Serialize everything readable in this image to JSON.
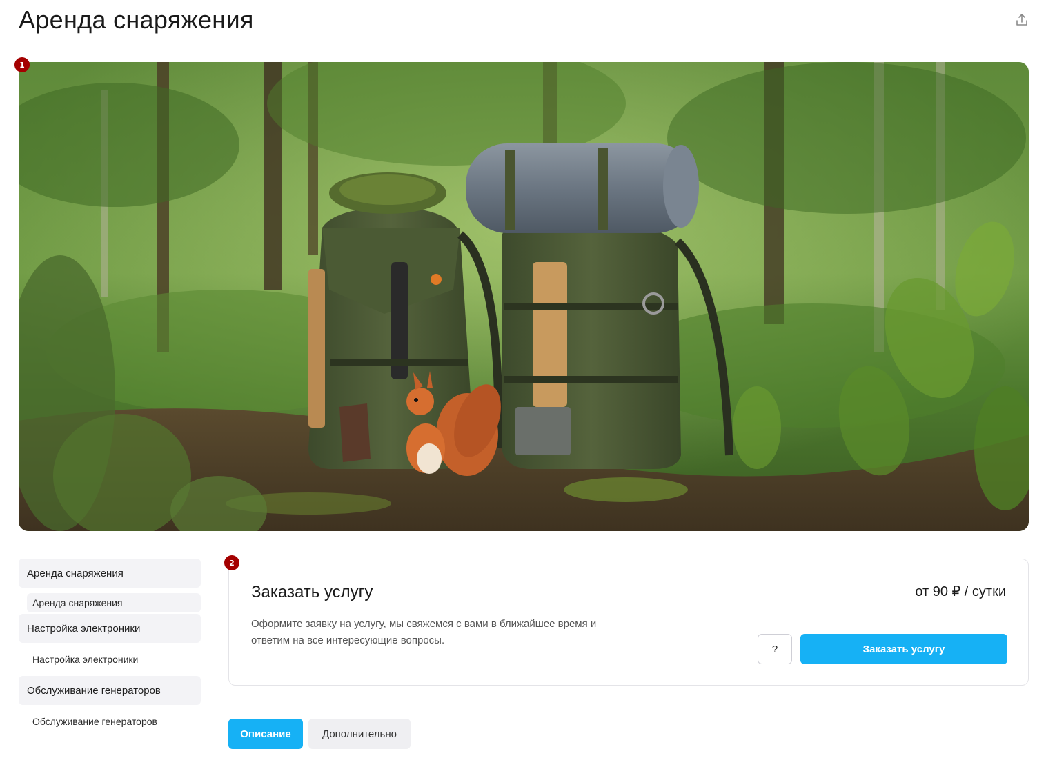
{
  "page": {
    "title": "Аренда снаряжения"
  },
  "markers": [
    "1",
    "2"
  ],
  "icons": {
    "share": "share-upload-icon"
  },
  "sidebar": {
    "items": [
      {
        "label": "Аренда снаряжения",
        "sub": "Аренда снаряжения"
      },
      {
        "label": "Настройка электроники",
        "sub": "Настройка электроники"
      },
      {
        "label": "Обслуживание генераторов",
        "sub": "Обслуживание генераторов"
      }
    ]
  },
  "service": {
    "title": "Заказать услугу",
    "price": "от 90 ₽ / сутки",
    "description": "Оформите заявку на услугу, мы свяжемся с вами в ближайшее время и ответим на все интересующие вопросы.",
    "help_label": "?",
    "order_label": "Заказать услугу"
  },
  "tabs": [
    {
      "label": "Описание",
      "active": true
    },
    {
      "label": "Дополнительно",
      "active": false
    }
  ],
  "colors": {
    "accent": "#16b1f5",
    "marker": "#a40000",
    "sidebar_bg": "#f3f3f6",
    "tab_inactive_bg": "#efeff2"
  }
}
